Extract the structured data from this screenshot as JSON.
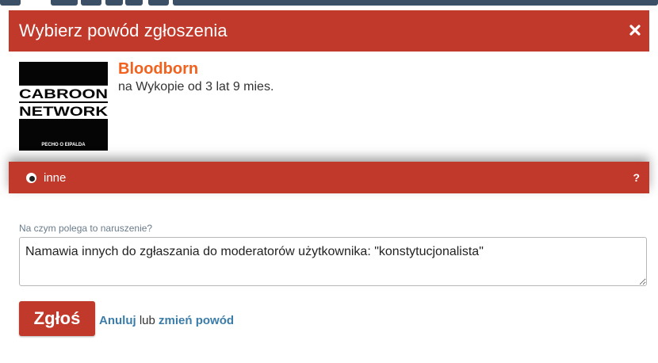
{
  "dialog": {
    "title": "Wybierz powód zgłoszenia",
    "close_icon": "close-icon"
  },
  "user": {
    "name": "Bloodborn",
    "member_since": "na Wykopie od 3 lat 9 mies.",
    "avatar_lines": [
      "CABROON",
      "NETWORK"
    ],
    "avatar_caption": "PECHO O EIPALDA"
  },
  "reason": {
    "label": "inne",
    "help": "?",
    "selected": true
  },
  "form": {
    "field_label": "Na czym polega to naruszenie?",
    "field_value": "Namawia innych do zgłaszania do moderatorów użytkownika: \"konstytucjonalista\"",
    "submit_label": "Zgłoś",
    "cancel_label": "Anuluj",
    "or_text": "lub",
    "change_reason_label": "zmień powód"
  },
  "colors": {
    "brand_red": "#c0392b",
    "username_orange": "#f1621f",
    "link_blue": "#3b7ca8"
  }
}
